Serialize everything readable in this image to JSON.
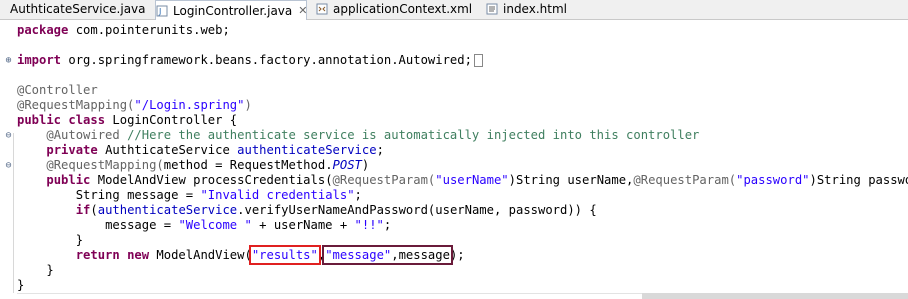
{
  "tabs": [
    {
      "label": "AuthticateService.java",
      "icon": "java-file-icon",
      "active": false
    },
    {
      "label": "LoginController.java",
      "icon": "java-file-icon",
      "active": true,
      "close": "✕"
    },
    {
      "label": "applicationContext.xml",
      "icon": "xml-file-icon",
      "active": false
    },
    {
      "label": "index.html",
      "icon": "html-file-icon",
      "active": false
    }
  ],
  "code": {
    "l1": {
      "kw": "package",
      "rest": " com.pointerunits.web;"
    },
    "l2": {
      "kw": "import",
      "rest": " org.springframework.beans.factory.annotation.Autowired;"
    },
    "l3": {
      "ann": "@Controller"
    },
    "l4": {
      "ann": "@RequestMapping(",
      "str": "\"/Login.spring\"",
      "ann2": ")"
    },
    "l5": {
      "kw": "public class",
      "rest": " LoginController {"
    },
    "l6": {
      "ann": "@Autowired",
      "cmt": " //Here the authenticate service is automatically injected into this controller"
    },
    "l7": {
      "kw": "private",
      "rest": " AuthticateService ",
      "fld": "authenticateService",
      "end": ";"
    },
    "l8": {
      "ann": "@RequestMapping(",
      "rest": "method = RequestMethod.",
      "it": "POST",
      "end": ")"
    },
    "l9": {
      "kw": "public",
      "rest1": " ModelAndView processCredentials(",
      "ann1": "@RequestParam(",
      "str1": "\"userName\"",
      "rest2": ")String userName,",
      "ann2": "@RequestParam(",
      "str2": "\"password\"",
      "rest3": ")String password) {"
    },
    "l10": {
      "rest": "String message = ",
      "str": "\"Invalid credentials\"",
      "end": ";"
    },
    "l11": {
      "kw": "if",
      "rest1": "(",
      "fld": "authenticateService",
      "rest2": ".verifyUserNameAndPassword(userName, password)) {"
    },
    "l12": {
      "rest1": "message = ",
      "str1": "\"Welcome \"",
      "rest2": " + userName + ",
      "str2": "\"!!\"",
      "end": ";"
    },
    "l13": {
      "rest": "}"
    },
    "l14": {
      "kw": "return new",
      "rest1": " ModelAndView(",
      "str1": "\"results\"",
      "sep": ",",
      "str2": "\"message\"",
      "rest2": ",message",
      "end": ");"
    },
    "l15": {
      "rest": "}"
    },
    "l16": {
      "rest": "}"
    }
  },
  "colors": {
    "keyword": "#7f0055",
    "annotation": "#646464",
    "string": "#2a00ff",
    "comment": "#3f7f5f",
    "field": "#0000c0",
    "highlight_red": "#e02020",
    "highlight_purple": "#6a1b3a"
  }
}
